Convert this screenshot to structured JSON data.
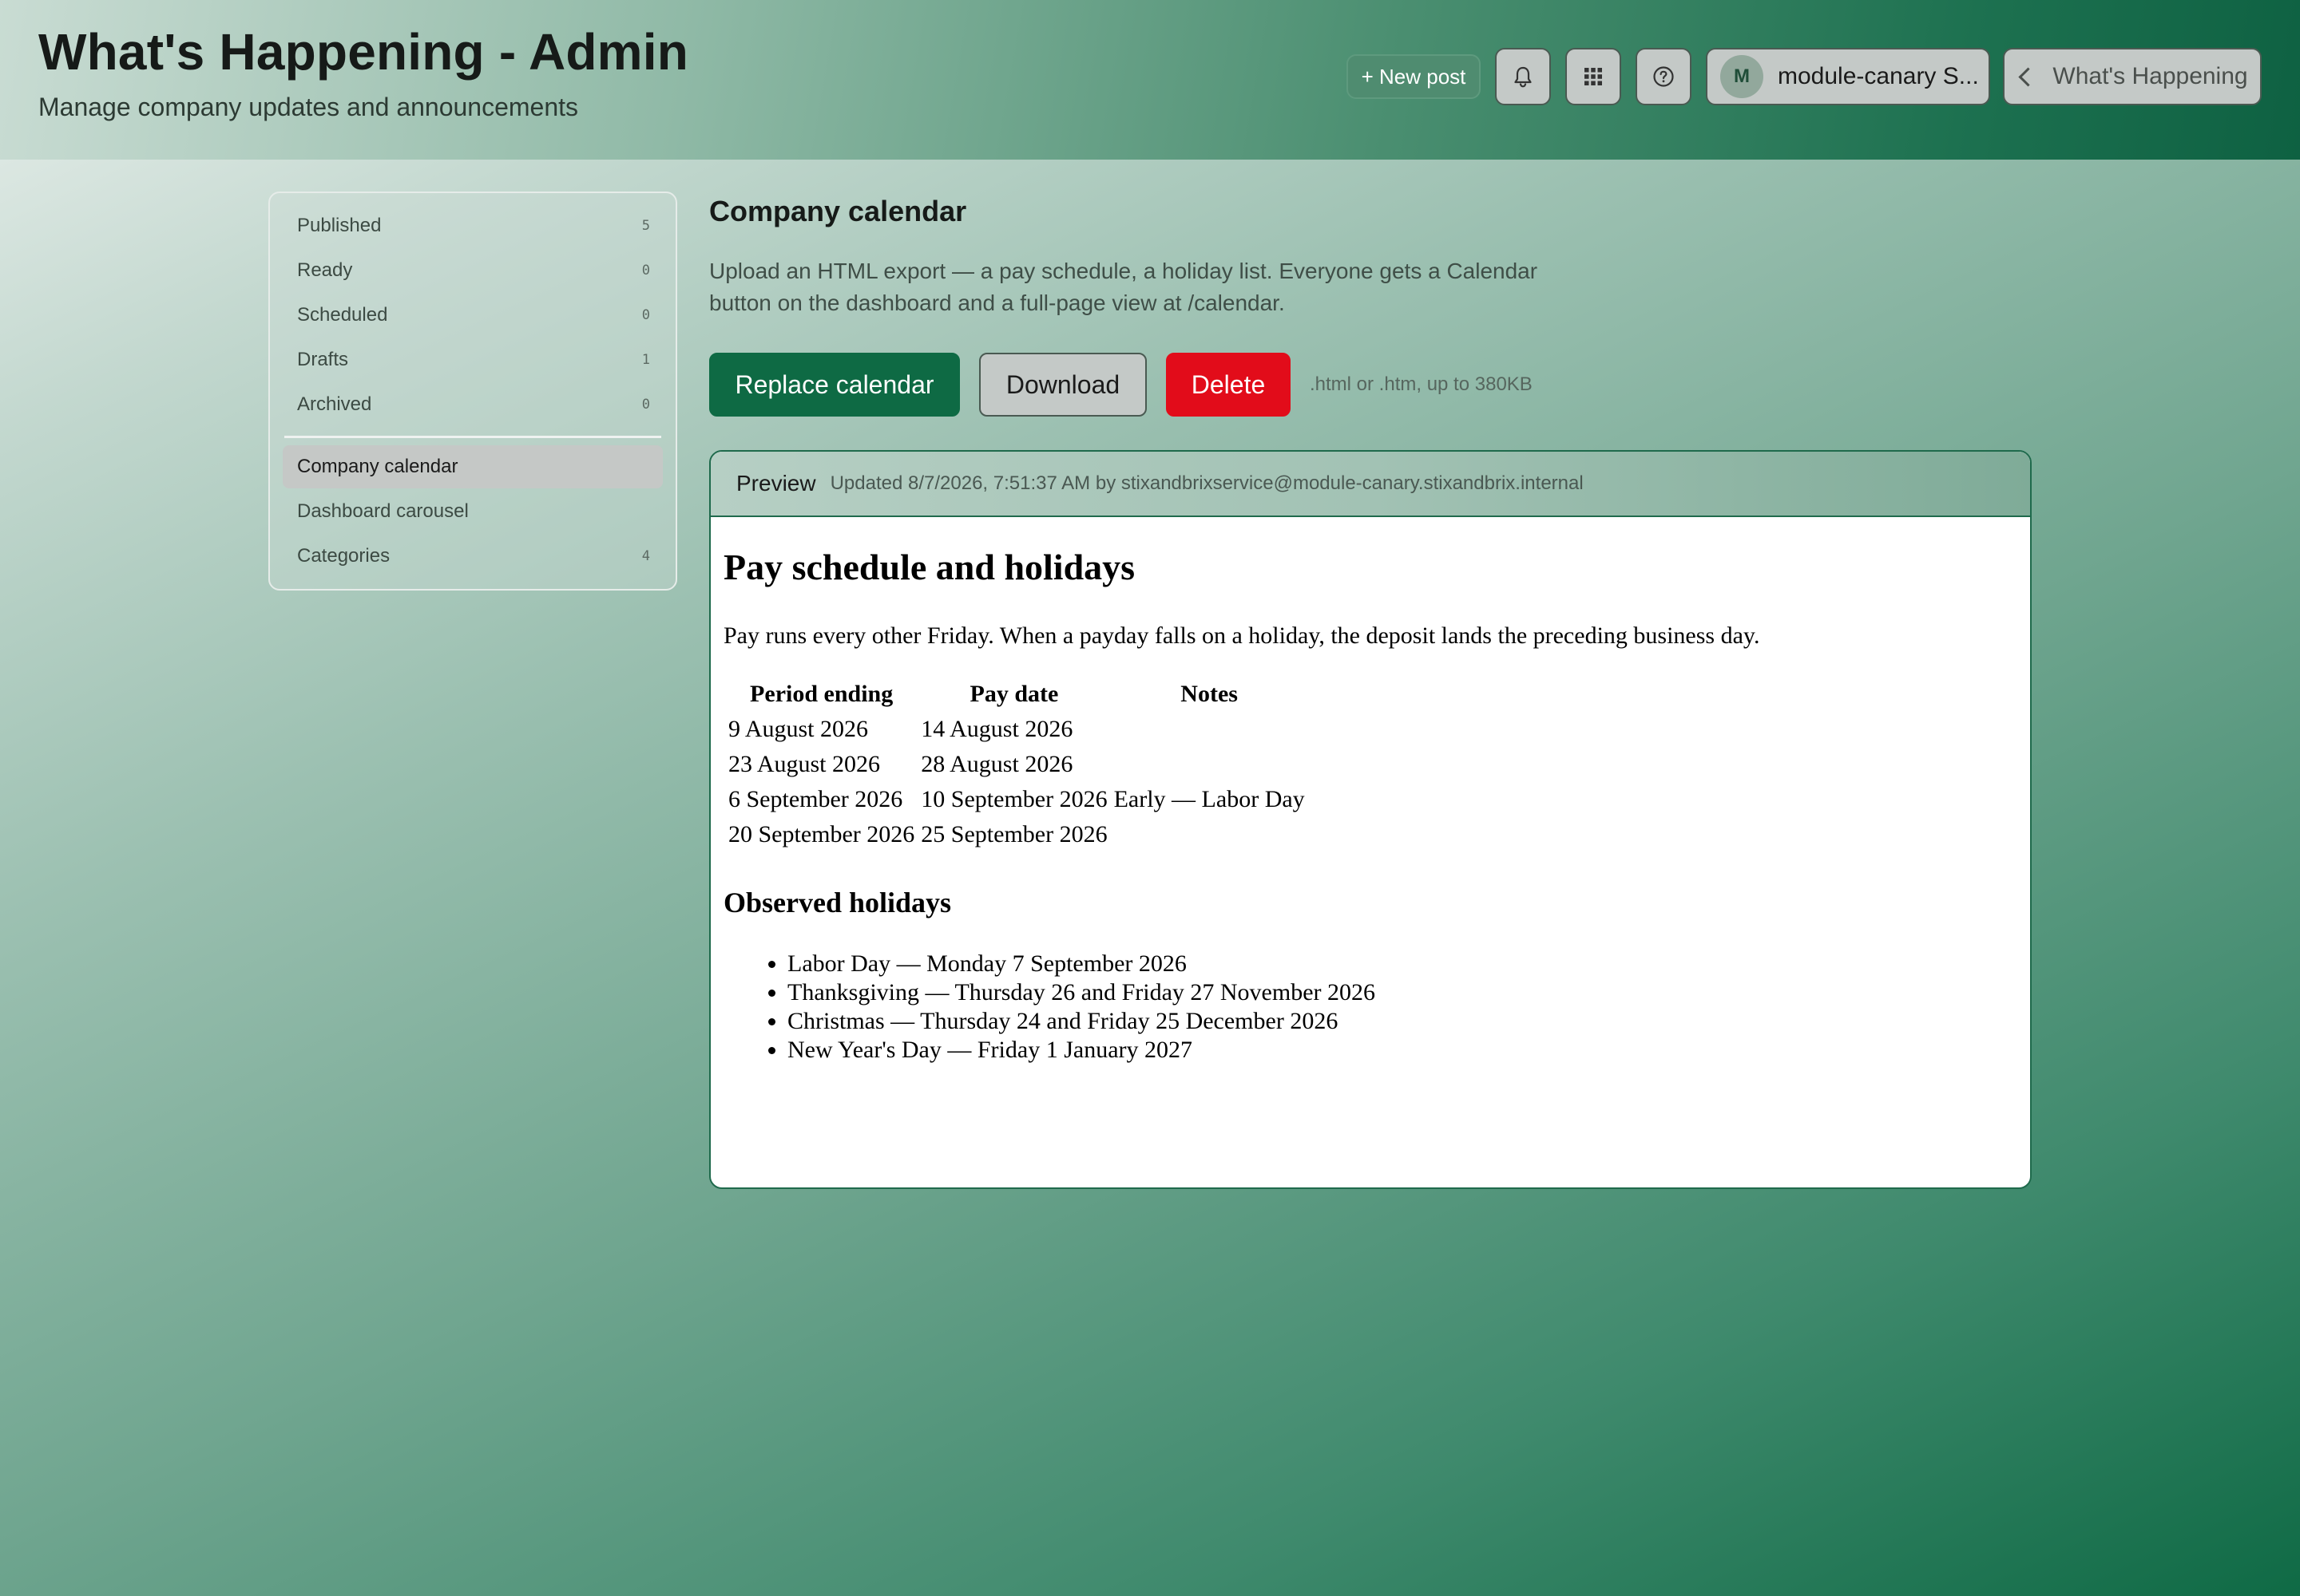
{
  "header": {
    "title": "What's Happening - Admin",
    "subtitle": "Manage company updates and announcements",
    "new_post_label": "+ New post",
    "icons": [
      "bell-icon",
      "apps-grid-icon",
      "help-icon"
    ],
    "account": {
      "avatar_initial": "M",
      "name": "module-canary S..."
    },
    "back_label": "What's Happening"
  },
  "sidebar": {
    "items": [
      {
        "label": "Published",
        "count": "5"
      },
      {
        "label": "Ready",
        "count": "0"
      },
      {
        "label": "Scheduled",
        "count": "0"
      },
      {
        "label": "Drafts",
        "count": "1"
      },
      {
        "label": "Archived",
        "count": "0"
      },
      {
        "label": "Company calendar",
        "count": "",
        "active": true
      },
      {
        "label": "Dashboard carousel",
        "count": ""
      },
      {
        "label": "Categories",
        "count": "4"
      }
    ]
  },
  "main": {
    "title": "Company calendar",
    "description": "Upload an HTML export — a pay schedule, a holiday list. Everyone gets a Calendar button on the dashboard and a full-page view at /calendar.",
    "actions": {
      "replace": "Replace calendar",
      "download": "Download",
      "delete": "Delete",
      "hint": ".html or .htm, up to 380KB"
    },
    "preview": {
      "label": "Preview",
      "updated": "Updated 8/7/2026, 7:51:37 AM by stixandbrixservice@module-canary.stixandbrix.internal"
    }
  },
  "document": {
    "heading": "Pay schedule and holidays",
    "intro": "Pay runs every other Friday. When a payday falls on a holiday, the deposit lands the preceding business day.",
    "table": {
      "headers": [
        "Period ending",
        "Pay date",
        "Notes"
      ],
      "rows": [
        [
          "9 August 2026",
          "14 August 2026",
          ""
        ],
        [
          "23 August 2026",
          "28 August 2026",
          ""
        ],
        [
          "6 September 2026",
          "10 September 2026",
          "Early — Labor Day"
        ],
        [
          "20 September 2026",
          "25 September 2026",
          ""
        ]
      ]
    },
    "holidays_heading": "Observed holidays",
    "holidays": [
      "Labor Day — Monday 7 September 2026",
      "Thanksgiving — Thursday 26 and Friday 27 November 2026",
      "Christmas — Thursday 24 and Friday 25 December 2026",
      "New Year's Day — Friday 1 January 2027"
    ]
  },
  "colors": {
    "primary": "#0e6a44",
    "danger": "#e20c1a",
    "new_post": "#4f8c70",
    "neutral_button": "#c4c9c7"
  }
}
